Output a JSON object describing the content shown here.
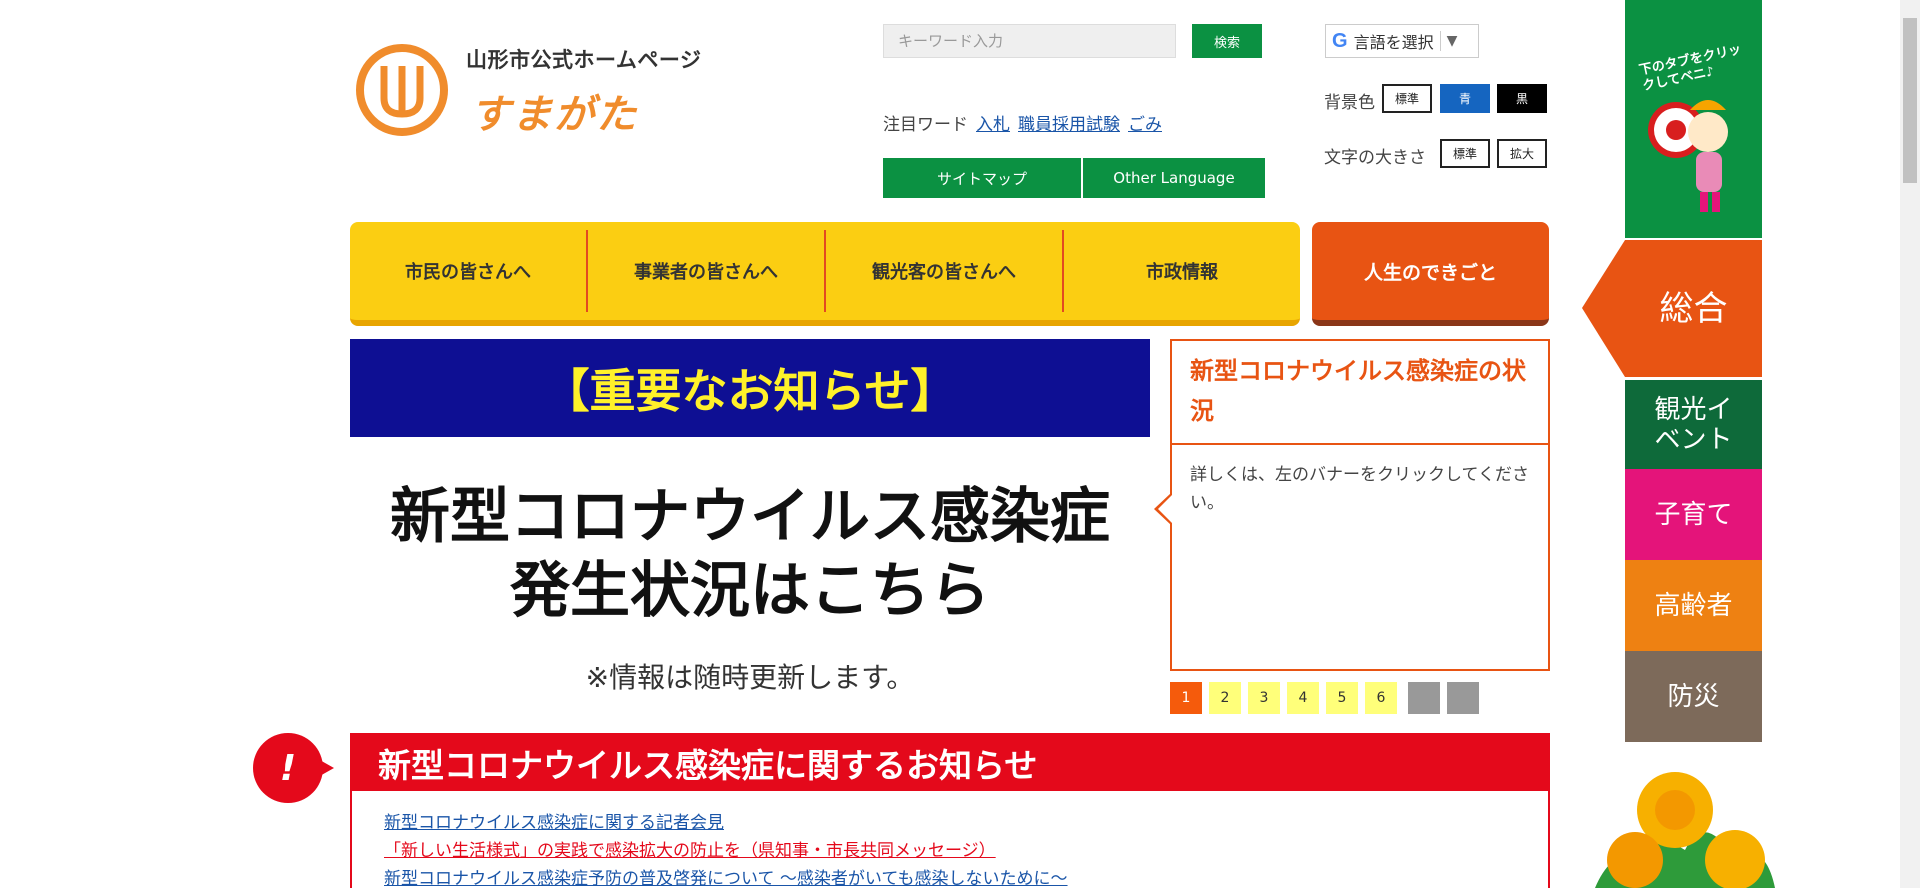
{
  "header": {
    "logo_title": "山形市公式ホームページ",
    "logo_sub": "すまがた",
    "search": {
      "placeholder": "キーワード入力",
      "button": "検索"
    },
    "hot_words": {
      "label": "注目ワード",
      "items": [
        "入札",
        "職員採用試験",
        "ごみ"
      ]
    },
    "sitemap": "サイトマップ",
    "other_language": "Other Language",
    "language_select": "言語を選択",
    "bg_color": {
      "label": "背景色",
      "options": [
        "標準",
        "青",
        "黒"
      ]
    },
    "text_size": {
      "label": "文字の大きさ",
      "options": [
        "標準",
        "拡大"
      ]
    }
  },
  "nav": {
    "items": [
      "市民の皆さんへ",
      "事業者の皆さんへ",
      "観光客の皆さんへ",
      "市政情報"
    ],
    "life": "人生のできごと"
  },
  "banner": {
    "top": "【重要なお知らせ】",
    "line1": "新型コロナウイルス感染症",
    "line2": "発生状況はこちら",
    "note": "※情報は随時更新します。"
  },
  "slide": {
    "title": "新型コロナウイルス感染症の状況",
    "text": "詳しくは、左のバナーをクリックしてください。",
    "pages": [
      "1",
      "2",
      "3",
      "4",
      "5",
      "6"
    ],
    "active_page": 1
  },
  "notice": {
    "title": "新型コロナウイルス感染症に関するお知らせ",
    "links": [
      "新型コロナウイルス感染症に関する記者会見",
      "「新しい生活様式」の実践で感染拡大の防止を（県知事・市長共同メッセージ）",
      "新型コロナウイルス感染症予防の普及啓発について ～感染者がいても感染しないために～"
    ]
  },
  "side_tabs": {
    "mascot_text": "下のタブをクリックしてベニ♪",
    "tabs": [
      {
        "label": "総合",
        "color": "#e85413"
      },
      {
        "label": "観光イベント",
        "color": "#0e6a3a"
      },
      {
        "label": "子育て",
        "color": "#e4147a"
      },
      {
        "label": "高齢者",
        "color": "#ee8112"
      },
      {
        "label": "防災",
        "color": "#7d6a5a"
      }
    ]
  }
}
